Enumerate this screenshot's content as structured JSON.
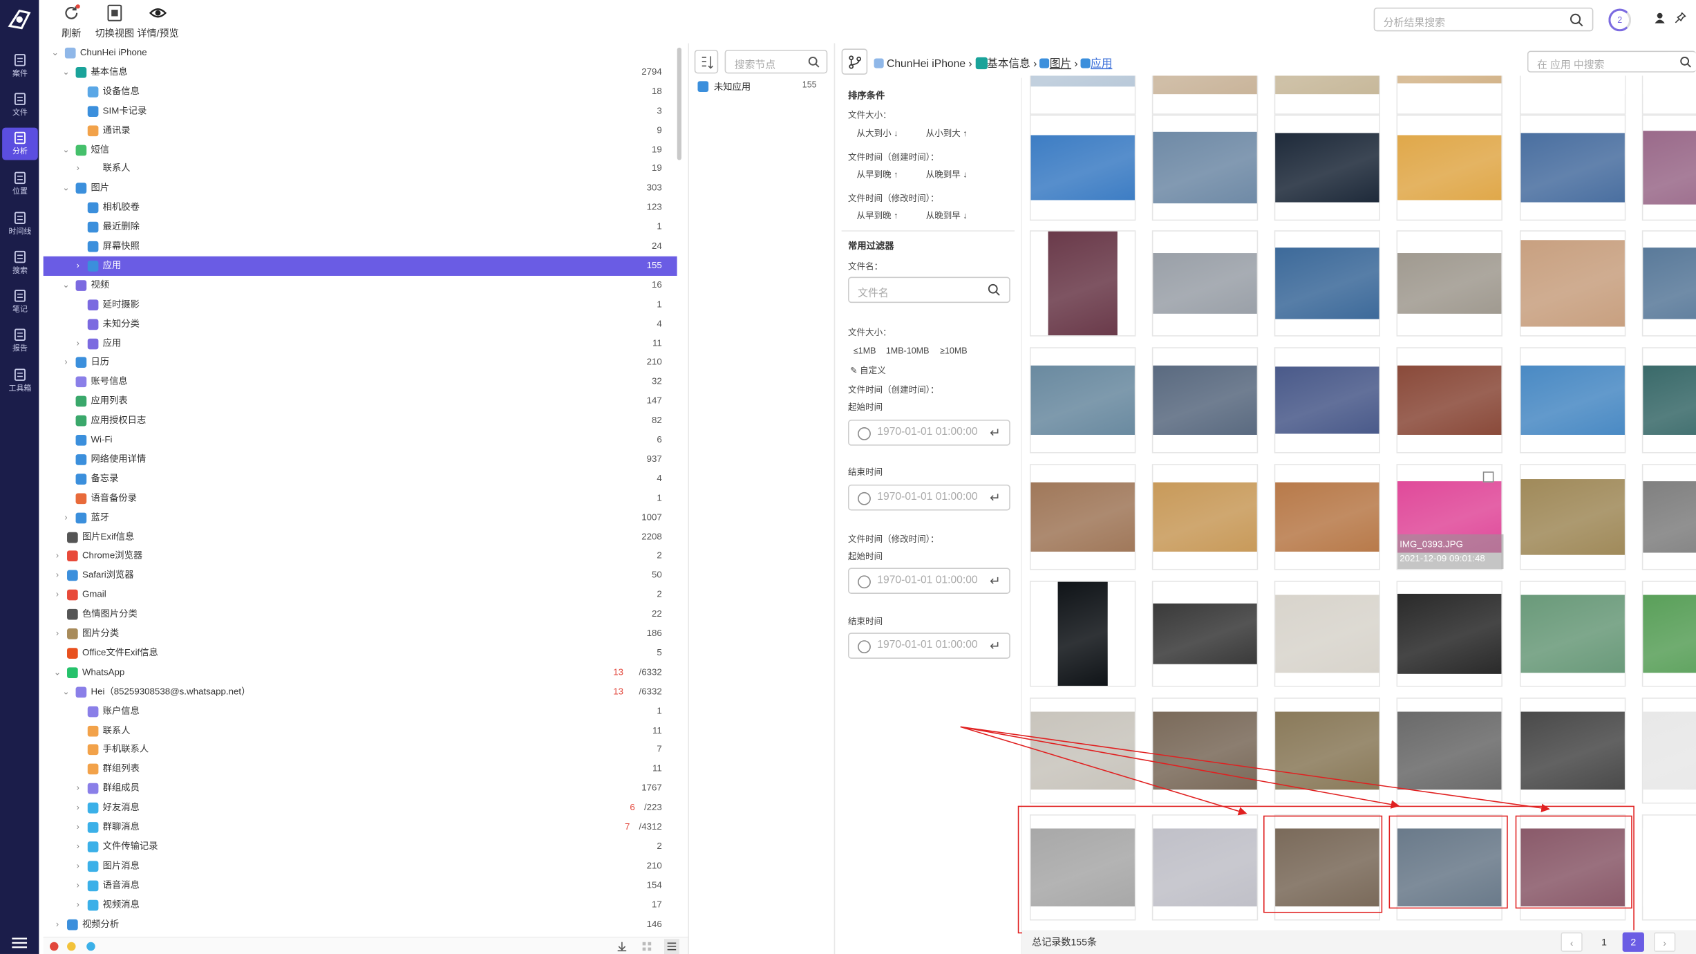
{
  "toolbar": {
    "refresh": "刷新",
    "switch_view": "切换视图",
    "details": "详情/预览"
  },
  "nav": [
    {
      "label": "案件",
      "icon": "case-icon"
    },
    {
      "label": "文件",
      "icon": "file-icon"
    },
    {
      "label": "分析",
      "icon": "analysis-icon",
      "active": true
    },
    {
      "label": "位置",
      "icon": "location-icon"
    },
    {
      "label": "时间线",
      "icon": "timeline-icon"
    },
    {
      "label": "搜索",
      "icon": "search-icon"
    },
    {
      "label": "笔记",
      "icon": "note-icon"
    },
    {
      "label": "报告",
      "icon": "report-icon"
    },
    {
      "label": "工具箱",
      "icon": "toolbox-icon"
    }
  ],
  "tree": [
    {
      "label": "ChunHei iPhone",
      "level": 0,
      "exp": "v",
      "count": "",
      "color": "#8fb7e8"
    },
    {
      "label": "基本信息",
      "level": 1,
      "exp": "v",
      "count": "2794",
      "color": "#1aa39a"
    },
    {
      "label": "设备信息",
      "level": 2,
      "exp": "",
      "count": "18",
      "color": "#5aa7e6"
    },
    {
      "label": "SIM卡记录",
      "level": 2,
      "exp": "",
      "count": "3",
      "color": "#3b8fdc"
    },
    {
      "label": "通讯录",
      "level": 2,
      "exp": "",
      "count": "9",
      "color": "#f2a24a"
    },
    {
      "label": "短信",
      "level": 1,
      "exp": "v",
      "count": "19",
      "color": "#45c06b"
    },
    {
      "label": "联系人",
      "level": 2,
      "exp": ">",
      "count": "19",
      "color": ""
    },
    {
      "label": "图片",
      "level": 1,
      "exp": "v",
      "count": "303",
      "color": "#3b8fdc"
    },
    {
      "label": "相机胶卷",
      "level": 2,
      "exp": "",
      "count": "123",
      "color": "#3b8fdc"
    },
    {
      "label": "最近删除",
      "level": 2,
      "exp": "",
      "count": "1",
      "color": "#3b8fdc"
    },
    {
      "label": "屏幕快照",
      "level": 2,
      "exp": "",
      "count": "24",
      "color": "#3b8fdc"
    },
    {
      "label": "应用",
      "level": 2,
      "exp": ">",
      "count": "155",
      "color": "#3b8fdc",
      "selected": true
    },
    {
      "label": "视频",
      "level": 1,
      "exp": "v",
      "count": "16",
      "color": "#7b6ae0"
    },
    {
      "label": "延时摄影",
      "level": 2,
      "exp": "",
      "count": "1",
      "color": "#7b6ae0"
    },
    {
      "label": "未知分类",
      "level": 2,
      "exp": "",
      "count": "4",
      "color": "#7b6ae0"
    },
    {
      "label": "应用",
      "level": 2,
      "exp": ">",
      "count": "11",
      "color": "#7b6ae0"
    },
    {
      "label": "日历",
      "level": 1,
      "exp": ">",
      "count": "210",
      "color": "#3b8fdc"
    },
    {
      "label": "账号信息",
      "level": 1,
      "exp": "",
      "count": "32",
      "color": "#8a7fe8"
    },
    {
      "label": "应用列表",
      "level": 1,
      "exp": "",
      "count": "147",
      "color": "#3aa86b"
    },
    {
      "label": "应用授权日志",
      "level": 1,
      "exp": "",
      "count": "82",
      "color": "#3aa86b"
    },
    {
      "label": "Wi-Fi",
      "level": 1,
      "exp": "",
      "count": "6",
      "color": "#3b8fdc"
    },
    {
      "label": "网络使用详情",
      "level": 1,
      "exp": "",
      "count": "937",
      "color": "#3b8fdc"
    },
    {
      "label": "备忘录",
      "level": 1,
      "exp": "",
      "count": "4",
      "color": "#3b8fdc"
    },
    {
      "label": "语音备份录",
      "level": 1,
      "exp": "",
      "count": "1",
      "color": "#e86a3a"
    },
    {
      "label": "蓝牙",
      "level": 1,
      "exp": ">",
      "count": "1007",
      "color": "#3b8fdc"
    },
    {
      "label": "图片Exif信息",
      "level": 0.5,
      "exp": "",
      "count": "2208",
      "color": "#555"
    },
    {
      "label": "Chrome浏览器",
      "level": 0.5,
      "exp": ">",
      "count": "2",
      "color": "#e84a3a"
    },
    {
      "label": "Safari浏览器",
      "level": 0.5,
      "exp": ">",
      "count": "50",
      "color": "#3b8fdc"
    },
    {
      "label": "Gmail",
      "level": 0.5,
      "exp": ">",
      "count": "2",
      "color": "#e84a3a"
    },
    {
      "label": "色情图片分类",
      "level": 0.5,
      "exp": "",
      "count": "22",
      "color": "#555"
    },
    {
      "label": "图片分类",
      "level": 0.5,
      "exp": ">",
      "count": "186",
      "color": "#a88b5a"
    },
    {
      "label": "Office文件Exif信息",
      "level": 0.5,
      "exp": "",
      "count": "5",
      "color": "#e8501e"
    },
    {
      "label": "WhatsApp",
      "level": 0.5,
      "exp": "v",
      "red": "13",
      "count": "/6332",
      "color": "#25c26b"
    },
    {
      "label": "Hei（85259308538@s.whatsapp.net）",
      "level": 1,
      "exp": "v",
      "red": "13",
      "count": "/6332",
      "color": "#8a7fe8"
    },
    {
      "label": "账户信息",
      "level": 2,
      "exp": "",
      "count": "1",
      "color": "#8a7fe8"
    },
    {
      "label": "联系人",
      "level": 2,
      "exp": "",
      "count": "11",
      "color": "#f2a24a"
    },
    {
      "label": "手机联系人",
      "level": 2,
      "exp": "",
      "count": "7",
      "color": "#f2a24a"
    },
    {
      "label": "群组列表",
      "level": 2,
      "exp": "",
      "count": "11",
      "color": "#f2a24a"
    },
    {
      "label": "群组成员",
      "level": 2,
      "exp": ">",
      "count": "1767",
      "color": "#8a7fe8"
    },
    {
      "label": "好友消息",
      "level": 2,
      "exp": ">",
      "red": "6",
      "count": "/223",
      "color": "#3bb0e8"
    },
    {
      "label": "群聊消息",
      "level": 2,
      "exp": ">",
      "red": "7",
      "count": "/4312",
      "color": "#3bb0e8"
    },
    {
      "label": "文件传输记录",
      "level": 2,
      "exp": ">",
      "count": "2",
      "color": "#3bb0e8"
    },
    {
      "label": "图片消息",
      "level": 2,
      "exp": ">",
      "count": "210",
      "color": "#3bb0e8"
    },
    {
      "label": "语音消息",
      "level": 2,
      "exp": ">",
      "count": "154",
      "color": "#3bb0e8"
    },
    {
      "label": "视频消息",
      "level": 2,
      "exp": ">",
      "count": "17",
      "color": "#3bb0e8"
    },
    {
      "label": "视频分析",
      "level": 0.5,
      "exp": ">",
      "count": "146",
      "color": "#3b8fdc"
    }
  ],
  "middle": {
    "search_placeholder": "搜索节点",
    "item_label": "未知应用",
    "item_count": "155"
  },
  "top_search_placeholder": "分析结果搜索",
  "badge": "2",
  "breadcrumb": {
    "device": "ChunHei iPhone",
    "basic": "基本信息",
    "pictures": "图片",
    "app": "应用",
    "search_placeholder": "在 应用 中搜索"
  },
  "filter": {
    "sort_title": "排序条件",
    "size_label": "文件大小：",
    "size_desc": "从大到小",
    "size_asc": "从小到大",
    "ctime_label": "文件时间（创建时间）：",
    "mtime_label": "文件时间（修改时间）：",
    "early_late": "从早到晚",
    "late_early": "从晚到早",
    "common_title": "常用过滤器",
    "filename_label": "文件名：",
    "filename_placeholder": "文件名",
    "size_filter_label": "文件大小：",
    "size_opt1": "≤1MB",
    "size_opt2": "1MB-10MB",
    "size_opt3": "≥10MB",
    "custom": "自定义",
    "ctime_filter_label": "文件时间（创建时间）：",
    "mtime_filter_label": "文件时间（修改时间）：",
    "start_label": "起始时间",
    "end_label": "结束时间",
    "date_value": "1970-01-01 01:00:00"
  },
  "hover": {
    "filename": "IMG_0393.JPG",
    "datetime": "2021-12-09 09:01:48"
  },
  "footer": {
    "total": "总记录数155条",
    "page1": "1",
    "page2": "2"
  }
}
